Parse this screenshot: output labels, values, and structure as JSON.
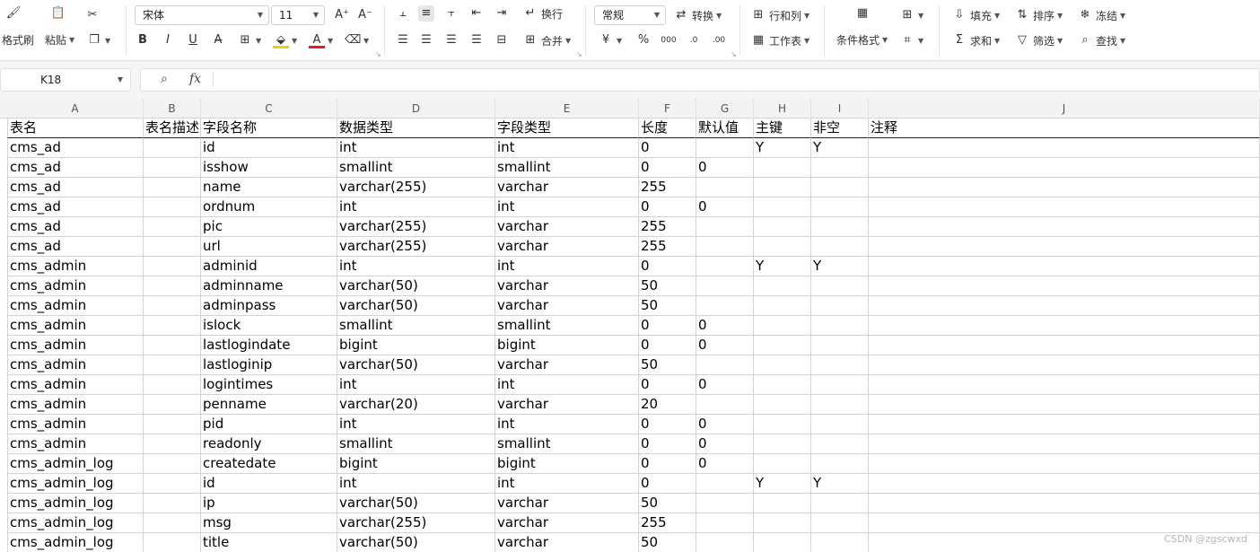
{
  "ribbon": {
    "format_painter": "格式刷",
    "paste": "粘贴",
    "font_name": "宋体",
    "font_size": "11",
    "bold": "B",
    "italic": "I",
    "underline": "U",
    "wrap": "换行",
    "merge": "合并",
    "number_format": "常规",
    "convert": "转换",
    "rows_cols": "行和列",
    "worksheet": "工作表",
    "cond_format": "条件格式",
    "fill": "填充",
    "sort": "排序",
    "freeze": "冻结",
    "sum": "求和",
    "filter": "筛选",
    "find": "查找"
  },
  "formula_bar": {
    "cell_ref": "K18",
    "fx": "fx",
    "content": ""
  },
  "columns": [
    "A",
    "B",
    "C",
    "D",
    "E",
    "F",
    "G",
    "H",
    "I",
    "J"
  ],
  "header": [
    "表名",
    "表名描述",
    "字段名称",
    "数据类型",
    "字段类型",
    "长度",
    "默认值",
    "主键",
    "非空",
    "注释"
  ],
  "rows": [
    [
      "cms_ad",
      "",
      "id",
      "int",
      "int",
      "0",
      "",
      "Y",
      "Y",
      ""
    ],
    [
      "cms_ad",
      "",
      "isshow",
      "smallint",
      "smallint",
      "0",
      "0",
      "",
      "",
      ""
    ],
    [
      "cms_ad",
      "",
      "name",
      "varchar(255)",
      "varchar",
      "255",
      "",
      "",
      "",
      ""
    ],
    [
      "cms_ad",
      "",
      "ordnum",
      "int",
      "int",
      "0",
      "0",
      "",
      "",
      ""
    ],
    [
      "cms_ad",
      "",
      "pic",
      "varchar(255)",
      "varchar",
      "255",
      "",
      "",
      "",
      ""
    ],
    [
      "cms_ad",
      "",
      "url",
      "varchar(255)",
      "varchar",
      "255",
      "",
      "",
      "",
      ""
    ],
    [
      "cms_admin",
      "",
      "adminid",
      "int",
      "int",
      "0",
      "",
      "Y",
      "Y",
      ""
    ],
    [
      "cms_admin",
      "",
      "adminname",
      "varchar(50)",
      "varchar",
      "50",
      "",
      "",
      "",
      ""
    ],
    [
      "cms_admin",
      "",
      "adminpass",
      "varchar(50)",
      "varchar",
      "50",
      "",
      "",
      "",
      ""
    ],
    [
      "cms_admin",
      "",
      "islock",
      "smallint",
      "smallint",
      "0",
      "0",
      "",
      "",
      ""
    ],
    [
      "cms_admin",
      "",
      "lastlogindate",
      "bigint",
      "bigint",
      "0",
      "0",
      "",
      "",
      ""
    ],
    [
      "cms_admin",
      "",
      "lastloginip",
      "varchar(50)",
      "varchar",
      "50",
      "",
      "",
      "",
      ""
    ],
    [
      "cms_admin",
      "",
      "logintimes",
      "int",
      "int",
      "0",
      "0",
      "",
      "",
      ""
    ],
    [
      "cms_admin",
      "",
      "penname",
      "varchar(20)",
      "varchar",
      "20",
      "",
      "",
      "",
      ""
    ],
    [
      "cms_admin",
      "",
      "pid",
      "int",
      "int",
      "0",
      "0",
      "",
      "",
      ""
    ],
    [
      "cms_admin",
      "",
      "readonly",
      "smallint",
      "smallint",
      "0",
      "0",
      "",
      "",
      ""
    ],
    [
      "cms_admin_log",
      "",
      "createdate",
      "bigint",
      "bigint",
      "0",
      "0",
      "",
      "",
      ""
    ],
    [
      "cms_admin_log",
      "",
      "id",
      "int",
      "int",
      "0",
      "",
      "Y",
      "Y",
      ""
    ],
    [
      "cms_admin_log",
      "",
      "ip",
      "varchar(50)",
      "varchar",
      "50",
      "",
      "",
      "",
      ""
    ],
    [
      "cms_admin_log",
      "",
      "msg",
      "varchar(255)",
      "varchar",
      "255",
      "",
      "",
      "",
      ""
    ],
    [
      "cms_admin_log",
      "",
      "title",
      "varchar(50)",
      "varchar",
      "50",
      "",
      "",
      "",
      ""
    ]
  ],
  "watermark": "CSDN @zgscwxd",
  "colors": {
    "accent": "#217346",
    "font_color": "#e02020",
    "highlight": "#f5d000"
  }
}
